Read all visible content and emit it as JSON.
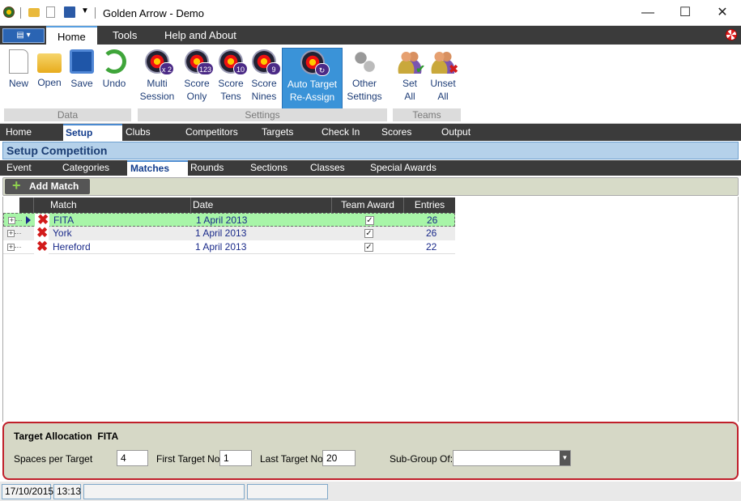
{
  "window": {
    "title": "Golden Arrow - Demo",
    "controls": [
      "minimize-icon",
      "maximize-icon",
      "close-icon"
    ]
  },
  "ribbon_tabs": [
    "Home",
    "Tools",
    "Help and About"
  ],
  "ribbon": {
    "data_group": {
      "label": "Data",
      "buttons": [
        "New",
        "Open",
        "Save",
        "Undo"
      ]
    },
    "settings_group": {
      "label": "Settings",
      "buttons": [
        {
          "line1": "Multi",
          "line2": "Session",
          "badge": "x 2"
        },
        {
          "line1": "Score",
          "line2": "Only",
          "badge": "123"
        },
        {
          "line1": "Score",
          "line2": "Tens",
          "badge": "10"
        },
        {
          "line1": "Score",
          "line2": "Nines",
          "badge": "9"
        },
        {
          "line1": "Auto Target",
          "line2": "Re-Assign"
        },
        {
          "line1": "Other",
          "line2": "Settings"
        }
      ]
    },
    "teams_group": {
      "label": "Teams",
      "buttons": [
        {
          "line1": "Set",
          "line2": "All"
        },
        {
          "line1": "Unset",
          "line2": "All"
        }
      ]
    }
  },
  "nav_main": [
    "Home",
    "Setup",
    "Clubs",
    "Competitors",
    "Targets",
    "Check In",
    "Scores",
    "Output"
  ],
  "section_title": "Setup Competition",
  "nav_setup": [
    "Event",
    "Categories",
    "Matches",
    "Rounds",
    "Sections",
    "Classes",
    "Special Awards"
  ],
  "toolbar": {
    "add_match": "Add Match"
  },
  "grid": {
    "columns": [
      "Match",
      "Date",
      "Team Award",
      "Entries"
    ],
    "rows": [
      {
        "match": "FITA",
        "date": "1 April 2013",
        "team_award": true,
        "entries": "26"
      },
      {
        "match": "York",
        "date": "1 April 2013",
        "team_award": true,
        "entries": "26"
      },
      {
        "match": "Hereford",
        "date": "1 April 2013",
        "team_award": true,
        "entries": "22"
      }
    ]
  },
  "target_allocation": {
    "title": "Target Allocation",
    "match_name": "FITA",
    "spaces_label": "Spaces per Target",
    "spaces_value": "4",
    "first_label": "First Target No",
    "first_value": "1",
    "last_label": "Last Target No",
    "last_value": "20",
    "subgroup_label": "Sub-Group Of:",
    "subgroup_value": ""
  },
  "status": {
    "date": "17/10/2015",
    "time": "13:13"
  },
  "colors": {
    "accent": "#3a93d8",
    "selected_row": "#a8f5a8",
    "panel_border": "#c01f2a",
    "header_dark": "#3b3b3b"
  }
}
